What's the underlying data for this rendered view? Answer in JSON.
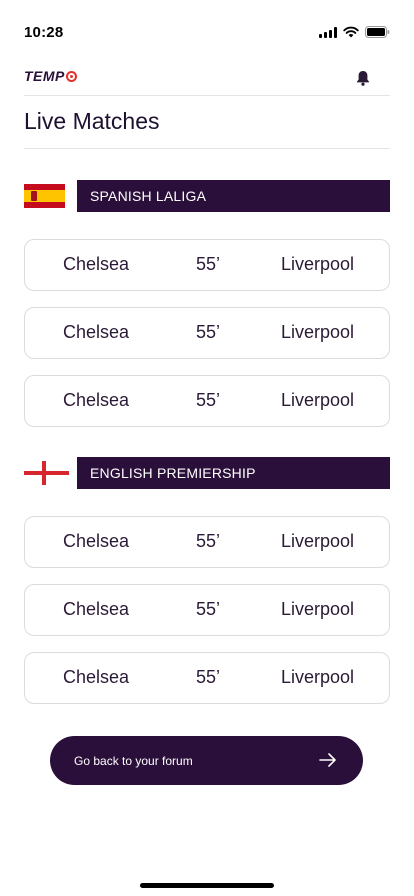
{
  "status_bar": {
    "time": "10:28"
  },
  "header": {
    "logo_text": "TEMP",
    "notification_icon": "bell-icon"
  },
  "page": {
    "title": "Live Matches"
  },
  "leagues": [
    {
      "name": "SPANISH LALIGA",
      "flag": "spain-flag-icon",
      "matches": [
        {
          "home": "Chelsea",
          "minute": "55’",
          "away": "Liverpool"
        },
        {
          "home": "Chelsea",
          "minute": "55’",
          "away": "Liverpool"
        },
        {
          "home": "Chelsea",
          "minute": "55’",
          "away": "Liverpool"
        }
      ]
    },
    {
      "name": "ENGLISH PREMIERSHIP",
      "flag": "england-flag-icon",
      "matches": [
        {
          "home": "Chelsea",
          "minute": "55’",
          "away": "Liverpool"
        },
        {
          "home": "Chelsea",
          "minute": "55’",
          "away": "Liverpool"
        },
        {
          "home": "Chelsea",
          "minute": "55’",
          "away": "Liverpool"
        }
      ]
    }
  ],
  "footer": {
    "forum_button_label": "Go back to your forum",
    "forum_button_icon": "arrow-right-icon"
  },
  "colors": {
    "brand": "#2a0f3a",
    "accent": "#e2302a",
    "card_border": "#dcdce0"
  }
}
